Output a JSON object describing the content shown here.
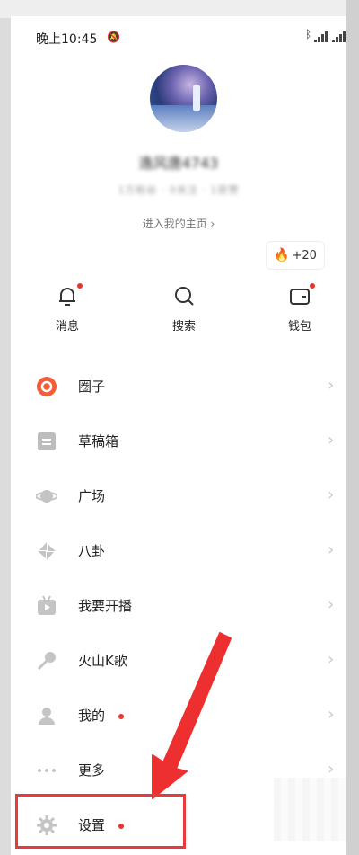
{
  "status_bar": {
    "time": "晚上10:45",
    "signal": "4G"
  },
  "profile": {
    "username": "逸风唐4743",
    "stats": "1万粉丝 · 0关注 · 1获赞",
    "homepage_link": "进入我的主页 ›",
    "fire_badge": "+20"
  },
  "quick_actions": [
    {
      "label": "消息",
      "icon": "bell-icon",
      "has_dot": true
    },
    {
      "label": "搜索",
      "icon": "search-icon",
      "has_dot": false
    },
    {
      "label": "钱包",
      "icon": "wallet-icon",
      "has_dot": true
    }
  ],
  "menu": [
    {
      "label": "圈子",
      "icon": "circle-icon"
    },
    {
      "label": "草稿箱",
      "icon": "drafts-icon"
    },
    {
      "label": "广场",
      "icon": "planet-icon"
    },
    {
      "label": "八卦",
      "icon": "pinwheel-icon"
    },
    {
      "label": "我要开播",
      "icon": "live-icon"
    },
    {
      "label": "火山K歌",
      "icon": "microphone-icon"
    },
    {
      "label": "我的",
      "icon": "user-icon",
      "has_dot": true
    },
    {
      "label": "更多",
      "icon": "more-icon"
    },
    {
      "label": "设置",
      "icon": "gear-icon",
      "has_dot": true
    }
  ],
  "colors": {
    "accent": "#e8352a",
    "annotation": "#e83a3a",
    "fire": "#ff5a2a"
  }
}
